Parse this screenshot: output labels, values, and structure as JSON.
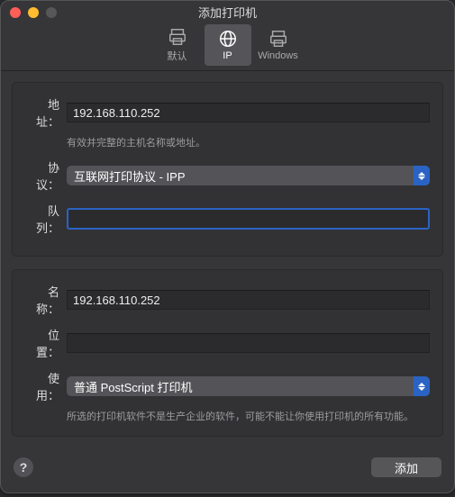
{
  "window": {
    "title": "添加打印机"
  },
  "toolbar": {
    "default_label": "默认",
    "ip_label": "IP",
    "windows_label": "Windows"
  },
  "form": {
    "address_label": "地址：",
    "address_value": "192.168.110.252",
    "address_hint": "有效并完整的主机名称或地址。",
    "protocol_label": "协议：",
    "protocol_value": "互联网打印协议 - IPP",
    "queue_label": "队列：",
    "queue_value": ""
  },
  "info": {
    "name_label": "名称：",
    "name_value": "192.168.110.252",
    "location_label": "位置：",
    "location_value": "",
    "use_label": "使用：",
    "use_value": "普通 PostScript 打印机",
    "use_hint": "所选的打印机软件不是生产企业的软件，可能不能让你使用打印机的所有功能。"
  },
  "footer": {
    "help_label": "?",
    "add_label": "添加"
  }
}
